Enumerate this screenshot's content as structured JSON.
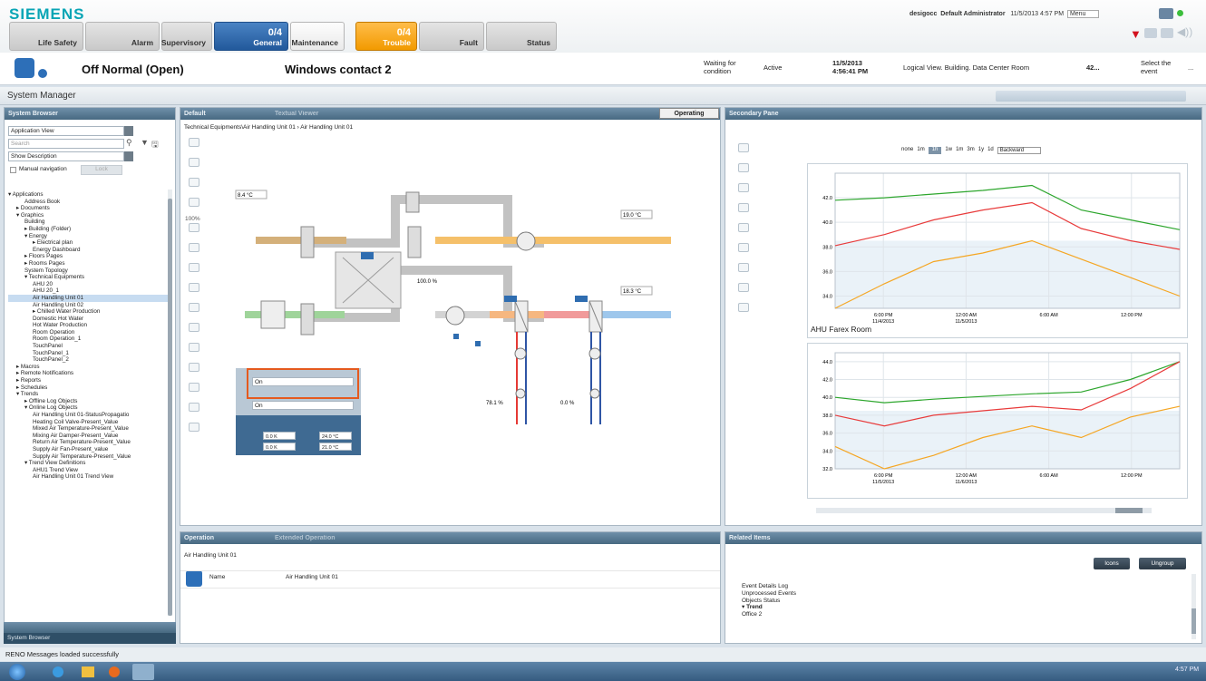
{
  "header": {
    "brand": "SIEMENS",
    "categories": [
      {
        "label": "Life Safety",
        "count": ""
      },
      {
        "label": "Alarm",
        "count": ""
      },
      {
        "label": "Supervisory",
        "count": ""
      },
      {
        "label": "General",
        "count": "0/4"
      },
      {
        "label": "Maintenance",
        "count": ""
      },
      {
        "label": "Trouble",
        "count": "0/4"
      },
      {
        "label": "Fault",
        "count": ""
      },
      {
        "label": "Status",
        "count": ""
      }
    ],
    "user": "desigocc",
    "role": "Default Administrator",
    "datetime": "11/5/2013  4:57 PM",
    "menu": "Menu"
  },
  "event": {
    "state": "Off Normal (Open)",
    "name": "Windows contact 2",
    "condition": "Waiting for condition",
    "status": "Active",
    "date": "11/5/2013",
    "time": "4:56:41 PM",
    "path": "Logical View. Building. Data Center Room",
    "count": "42...",
    "action": "Select the event",
    "more": "..."
  },
  "system_manager": {
    "title": "System Manager"
  },
  "left": {
    "header": "System Browser",
    "view": "Application View",
    "search_placeholder": "Search",
    "description": "Show Description",
    "manual_nav": "Manual navigation",
    "manual_nav_btn": "Lock",
    "tree": [
      {
        "t": "Applications",
        "d": 0,
        "x": "▾"
      },
      {
        "t": "Address Book",
        "d": 2,
        "x": ""
      },
      {
        "t": "Documents",
        "d": 1,
        "x": "▸"
      },
      {
        "t": "Graphics",
        "d": 1,
        "x": "▾"
      },
      {
        "t": "Building",
        "d": 2,
        "x": ""
      },
      {
        "t": "Building (Folder)",
        "d": 2,
        "x": "▸"
      },
      {
        "t": "Energy",
        "d": 2,
        "x": "▾"
      },
      {
        "t": "Electrical plan",
        "d": 3,
        "x": "▸"
      },
      {
        "t": "Energy Dashboard",
        "d": 3,
        "x": ""
      },
      {
        "t": "Floors Pages",
        "d": 2,
        "x": "▸"
      },
      {
        "t": "Rooms Pages",
        "d": 2,
        "x": "▸"
      },
      {
        "t": "System Topology",
        "d": 2,
        "x": ""
      },
      {
        "t": "Technical Equipments",
        "d": 2,
        "x": "▾"
      },
      {
        "t": "AHU 20",
        "d": 3,
        "x": ""
      },
      {
        "t": "AHU 20_1",
        "d": 3,
        "x": ""
      },
      {
        "t": "Air Handling Unit 01",
        "d": 3,
        "x": "",
        "sel": true
      },
      {
        "t": "Air Handling Unit 02",
        "d": 3,
        "x": ""
      },
      {
        "t": "Chilled Water Production",
        "d": 3,
        "x": "▸"
      },
      {
        "t": "Domestic Hot Water",
        "d": 3,
        "x": ""
      },
      {
        "t": "Hot Water Production",
        "d": 3,
        "x": ""
      },
      {
        "t": "Room Operation",
        "d": 3,
        "x": ""
      },
      {
        "t": "Room Operation_1",
        "d": 3,
        "x": ""
      },
      {
        "t": "TouchPanel",
        "d": 3,
        "x": ""
      },
      {
        "t": "TouchPanel_1",
        "d": 3,
        "x": ""
      },
      {
        "t": "TouchPanel_2",
        "d": 3,
        "x": ""
      },
      {
        "t": "Macros",
        "d": 1,
        "x": "▸"
      },
      {
        "t": "Remote Notifications",
        "d": 1,
        "x": "▸"
      },
      {
        "t": "Reports",
        "d": 1,
        "x": "▸"
      },
      {
        "t": "Schedules",
        "d": 1,
        "x": "▸"
      },
      {
        "t": "Trends",
        "d": 1,
        "x": "▾"
      },
      {
        "t": "Offline Log Objects",
        "d": 2,
        "x": "▸"
      },
      {
        "t": "Online Log Objects",
        "d": 2,
        "x": "▾"
      },
      {
        "t": "Air Handling Unit 01-StatusPropagatio",
        "d": 3,
        "x": ""
      },
      {
        "t": "Heating Coil Valve-Present_Value",
        "d": 3,
        "x": ""
      },
      {
        "t": "Mixed Air Temperature-Present_Value",
        "d": 3,
        "x": ""
      },
      {
        "t": "Mixing Air Damper-Present_Value",
        "d": 3,
        "x": ""
      },
      {
        "t": "Return Air Temperature-Present_Value",
        "d": 3,
        "x": ""
      },
      {
        "t": "Supply Air Fan-Present_value",
        "d": 3,
        "x": ""
      },
      {
        "t": "Supply Air Temperature-Present_Value",
        "d": 3,
        "x": ""
      },
      {
        "t": "Trend View Definitions",
        "d": 2,
        "x": "▾"
      },
      {
        "t": "AHU1 Trend View",
        "d": 3,
        "x": ""
      },
      {
        "t": "Air Handling Unit 01 Trend View",
        "d": 3,
        "x": ""
      }
    ],
    "footer1": "",
    "footer2": "System Browser"
  },
  "center": {
    "tab1": "Default",
    "tab2": "Textual Viewer",
    "mode": "Operating",
    "breadcrumb": "Technical Equipments\\Air Handling Unit 01  ›  Air Handling Unit 01",
    "zoom": "100%",
    "temps": {
      "t1": "8.4 °C",
      "t2": "19.0 °C",
      "t3": "18.3 °C"
    },
    "percents": {
      "p1": "100.0 %",
      "p2": "78.1 %",
      "p3": "0.0 %"
    },
    "ctrl": {
      "f1": "On",
      "f2": "On",
      "a1": "0.0 K",
      "a2": "24.0 °C",
      "b1": "0.0 K",
      "b2": "21.0 °C"
    }
  },
  "right": {
    "header": "Secondary Pane",
    "ranges": [
      "none",
      "1m",
      "1h",
      "1w",
      "1m",
      "3m",
      "1y",
      "1d"
    ],
    "direction": "Backward",
    "chart2_title": "AHU Farex Room"
  },
  "chart_data": [
    {
      "type": "line",
      "x": [
        "6:00 PM 11/4/2013",
        "12:00 AM 11/5/2013",
        "6:00 AM",
        "12:00 PM"
      ],
      "ylim": [
        33,
        44
      ],
      "yticks": [
        "42.0",
        "40.0",
        "38.0",
        "36.0",
        "34.0"
      ],
      "series": [
        {
          "color": "#2da62d",
          "values": [
            41.8,
            42.0,
            42.3,
            42.6,
            43.0,
            41.0,
            40.2,
            39.4
          ]
        },
        {
          "color": "#e83b3b",
          "values": [
            38.1,
            39.0,
            40.2,
            41.0,
            41.6,
            39.5,
            38.5,
            37.8
          ]
        },
        {
          "color": "#f5a623",
          "values": [
            33.0,
            35.0,
            36.8,
            37.5,
            38.5,
            37.0,
            35.5,
            34.0
          ]
        }
      ]
    },
    {
      "type": "line",
      "title": "AHU Farex Room",
      "x": [
        "6:00 PM 11/5/2013",
        "12:00 AM 11/6/2013",
        "6:00 AM",
        "12:00 PM"
      ],
      "ylim": [
        32,
        45
      ],
      "yticks": [
        "44.0",
        "42.0",
        "40.0",
        "38.0",
        "36.0",
        "34.0",
        "32.0"
      ],
      "series": [
        {
          "color": "#2da62d",
          "values": [
            40.0,
            39.4,
            39.8,
            40.1,
            40.4,
            40.6,
            42.0,
            44.0
          ]
        },
        {
          "color": "#e83b3b",
          "values": [
            38.0,
            36.8,
            38.0,
            38.5,
            39.0,
            38.6,
            41.0,
            44.0
          ]
        },
        {
          "color": "#f5a623",
          "values": [
            34.5,
            32.0,
            33.5,
            35.5,
            36.8,
            35.5,
            37.8,
            39.0
          ]
        }
      ]
    }
  ],
  "ops": {
    "tab1": "Operation",
    "tab2": "Extended Operation",
    "title": "Air Handling Unit 01",
    "field": "Name",
    "value": "Air Handling Unit 01"
  },
  "related": {
    "header": "Related Items",
    "btn_icons": "Icons",
    "btn_ungroup": "Ungroup",
    "items": [
      "Event Details Log",
      "Unprocessed Events",
      "Objects Status",
      "Trend",
      "Office 2"
    ]
  },
  "status_msg": "RENO Messages loaded successfully",
  "taskbar": {
    "time": "4:57 PM"
  }
}
